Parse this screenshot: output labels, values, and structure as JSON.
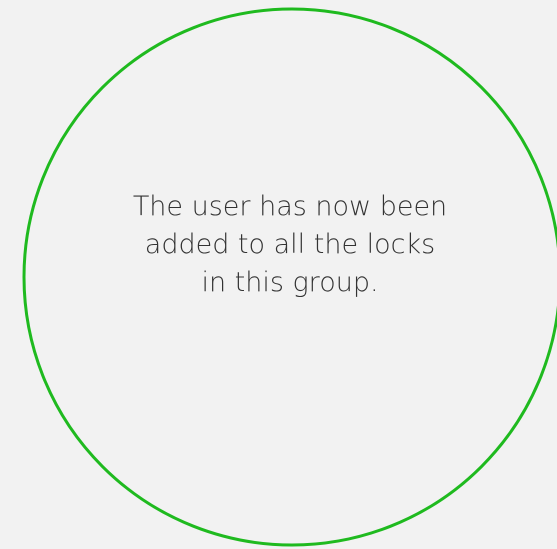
{
  "colors": {
    "background": "#f2f2f2",
    "ring": "#1fba1f",
    "text": "#333333"
  },
  "confirmation": {
    "lines": [
      "The user has now been",
      "added to all the locks",
      "in this group."
    ]
  }
}
